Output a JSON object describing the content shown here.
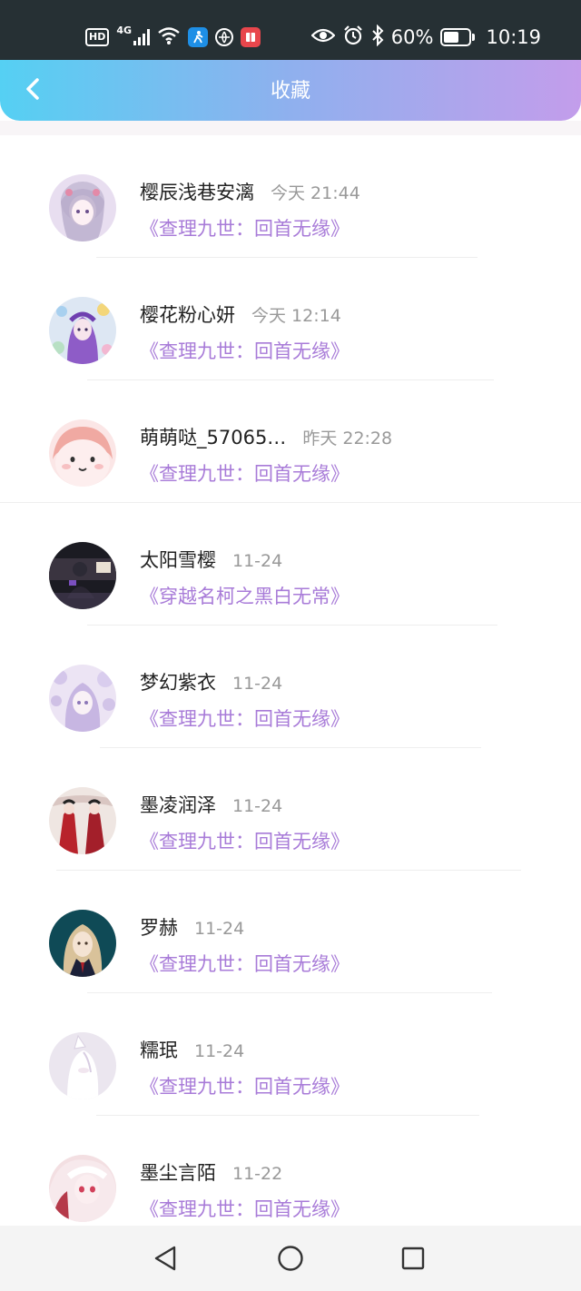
{
  "status_bar": {
    "hd_badge": "HD",
    "network": "4G",
    "battery_text": "60%",
    "battery_level": 0.6,
    "time": "10:19",
    "icons": [
      "hd-icon",
      "signal-icon",
      "wifi-icon",
      "blue-app-icon",
      "ball-app-icon",
      "red-app-icon",
      "eye-icon",
      "alarm-icon",
      "bluetooth-icon",
      "battery-icon"
    ]
  },
  "header": {
    "title": "收藏",
    "back_icon": "back-arrow-icon",
    "gradient": [
      "#55d0f3",
      "#c39deb"
    ]
  },
  "colors": {
    "name": "#222222",
    "time": "#999999",
    "work_title": "#a87bd8"
  },
  "favorites": [
    {
      "name": "樱辰浅巷安漓",
      "time": "今天 21:44",
      "work": "《查理九世：回首无缘》"
    },
    {
      "name": "樱花粉心妍",
      "time": "今天 12:14",
      "work": "《查理九世：回首无缘》"
    },
    {
      "name": "萌萌哒_57065…",
      "time": "昨天 22:28",
      "work": "《查理九世：回首无缘》"
    },
    {
      "name": "太阳雪樱",
      "time": "11-24",
      "work": "《穿越名柯之黑白无常》"
    },
    {
      "name": "梦幻紫衣",
      "time": "11-24",
      "work": "《查理九世：回首无缘》"
    },
    {
      "name": "墨凌润泽",
      "time": "11-24",
      "work": "《查理九世：回首无缘》"
    },
    {
      "name": "罗赫",
      "time": "11-24",
      "work": "《查理九世：回首无缘》"
    },
    {
      "name": "糯珉",
      "time": "11-24",
      "work": "《查理九世：回首无缘》"
    },
    {
      "name": "墨尘言陌",
      "time": "11-22",
      "work": "《查理九世：回首无缘》"
    }
  ],
  "nav_bar": {
    "icons": [
      "back-triangle-icon",
      "home-circle-icon",
      "recents-square-icon"
    ]
  }
}
